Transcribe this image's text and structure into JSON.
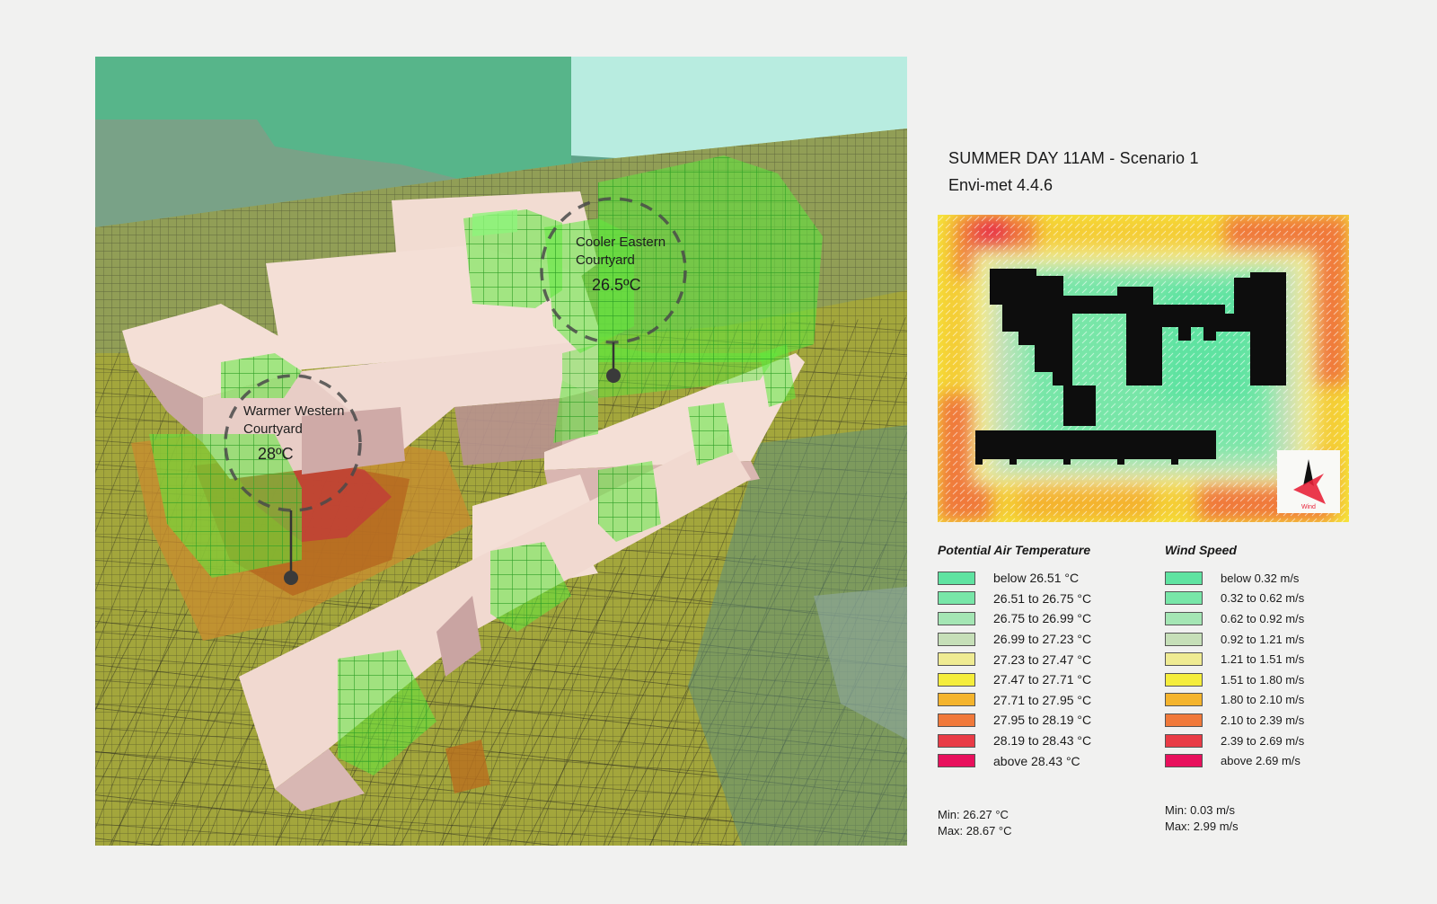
{
  "title_line1": "SUMMER DAY  11AM - Scenario 1",
  "title_line2": "Envi-met 4.4.6",
  "annotations": {
    "warm": {
      "line1": "Warmer Western",
      "line2": "Courtyard",
      "value": "28ºC"
    },
    "cool": {
      "line1": "Cooler Eastern",
      "line2": "Courtyard",
      "value": "26.5ºC"
    }
  },
  "wind_icon_label": "Wind",
  "legend_temperature": {
    "title": "Potential Air Temperature",
    "items": [
      {
        "label": "below 26.51 °C",
        "color": "#5fe3a1"
      },
      {
        "label": "26.51 to 26.75 °C",
        "color": "#78e6a8"
      },
      {
        "label": "26.75 to 26.99 °C",
        "color": "#a4e6b4"
      },
      {
        "label": "26.99 to 27.23 °C",
        "color": "#c6dfb8"
      },
      {
        "label": "27.23 to 27.47 °C",
        "color": "#efeb93"
      },
      {
        "label": "27.47 to 27.71 °C",
        "color": "#f5ed3c"
      },
      {
        "label": "27.71 to 27.95 °C",
        "color": "#f4b42d"
      },
      {
        "label": "27.95 to 28.19 °C",
        "color": "#f0793a"
      },
      {
        "label": "28.19 to 28.43 °C",
        "color": "#e93b46"
      },
      {
        "label": "above 28.43 °C",
        "color": "#e8105c"
      }
    ],
    "min": "Min: 26.27 °C",
    "max": "Max: 28.67 °C"
  },
  "legend_wind": {
    "title": "Wind Speed",
    "items": [
      {
        "label": "below 0.32 m/s",
        "color": "#5fe3a1"
      },
      {
        "label": "0.32 to 0.62 m/s",
        "color": "#78e6a8"
      },
      {
        "label": "0.62 to 0.92 m/s",
        "color": "#a4e6b4"
      },
      {
        "label": "0.92 to 1.21 m/s",
        "color": "#c6dfb8"
      },
      {
        "label": "1.21 to 1.51 m/s",
        "color": "#efeb93"
      },
      {
        "label": "1.51 to 1.80 m/s",
        "color": "#f5ed3c"
      },
      {
        "label": "1.80 to 2.10 m/s",
        "color": "#f4b42d"
      },
      {
        "label": "2.10 to 2.39 m/s",
        "color": "#f0793a"
      },
      {
        "label": "2.39 to 2.69 m/s",
        "color": "#e93b46"
      },
      {
        "label": "above 2.69 m/s",
        "color": "#e8105c"
      }
    ],
    "min": "Min: 0.03 m/s",
    "max": "Max: 2.99 m/s"
  }
}
